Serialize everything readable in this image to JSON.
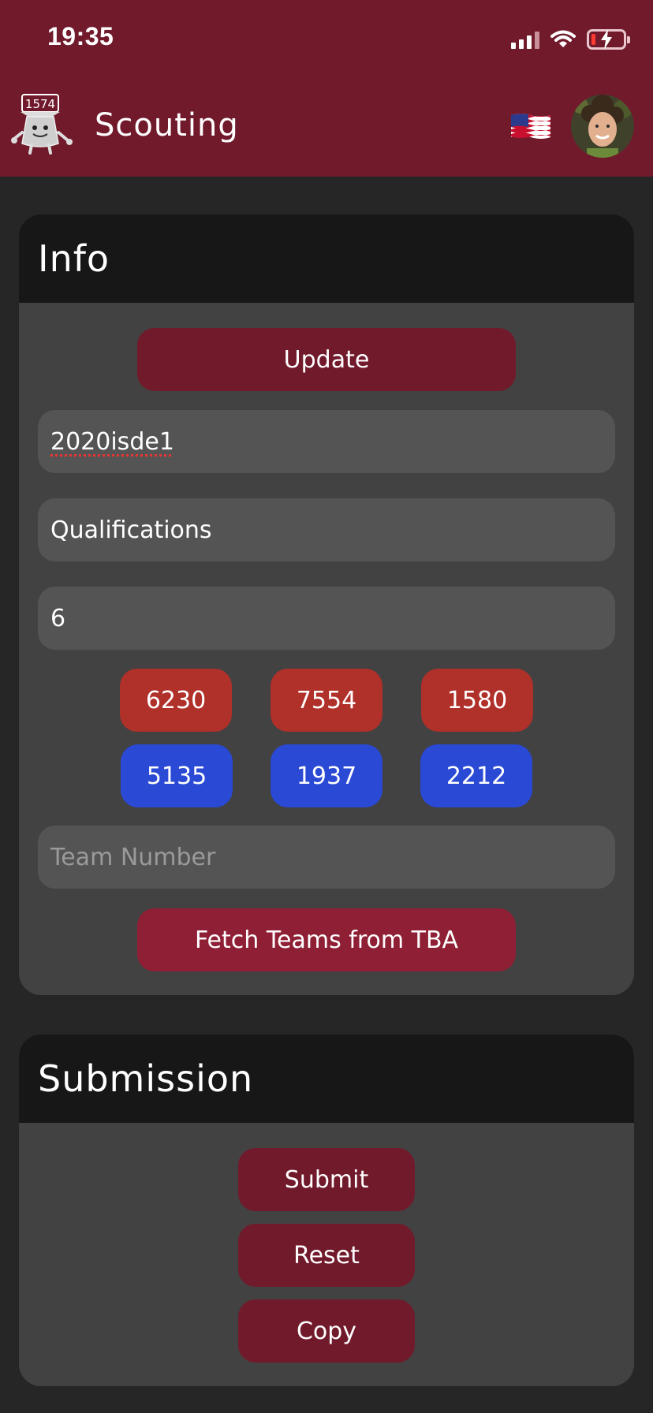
{
  "status_bar": {
    "time": "19:35"
  },
  "header": {
    "logo_text": "1574",
    "title": "Scouting"
  },
  "info": {
    "heading": "Info",
    "update_label": "Update",
    "event_value": "2020isde1",
    "match_type_value": "Qualifications",
    "match_number_value": "6",
    "red_alliance": [
      "6230",
      "7554",
      "1580"
    ],
    "blue_alliance": [
      "5135",
      "1937",
      "2212"
    ],
    "team_number_placeholder": "Team Number",
    "fetch_label": "Fetch Teams from TBA"
  },
  "submission": {
    "heading": "Submission",
    "submit_label": "Submit",
    "reset_label": "Reset",
    "copy_label": "Copy"
  },
  "colors": {
    "header": "#711a2c",
    "red_team": "#b0302a",
    "blue_team": "#2a49d4"
  }
}
